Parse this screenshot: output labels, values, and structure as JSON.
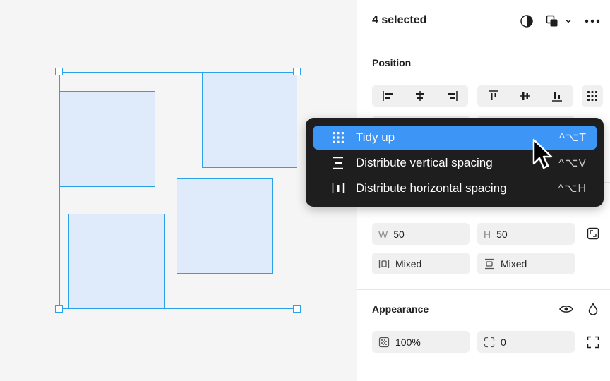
{
  "panel": {
    "title": "4 selected",
    "position": {
      "title": "Position"
    },
    "dimensions": {
      "w_label": "W",
      "w_value": "50",
      "h_label": "H",
      "h_value": "50",
      "h_gap_value": "Mixed",
      "v_gap_value": "Mixed"
    },
    "appearance": {
      "title": "Appearance",
      "opacity": "100%",
      "radius": "0"
    }
  },
  "menu": {
    "items": [
      {
        "label": "Tidy up",
        "shortcut": "^⌥T",
        "icon": "grid-dots-icon"
      },
      {
        "label": "Distribute vertical spacing",
        "shortcut": "^⌥V",
        "icon": "distribute-vertical-icon"
      },
      {
        "label": "Distribute horizontal spacing",
        "shortcut": "^⌥H",
        "icon": "distribute-horizontal-icon"
      }
    ]
  },
  "colors": {
    "selection": "#2ba1ea",
    "shape_fill": "#dfeafb",
    "menu_bg": "#1e1e1e",
    "menu_active": "#3d95f5"
  }
}
